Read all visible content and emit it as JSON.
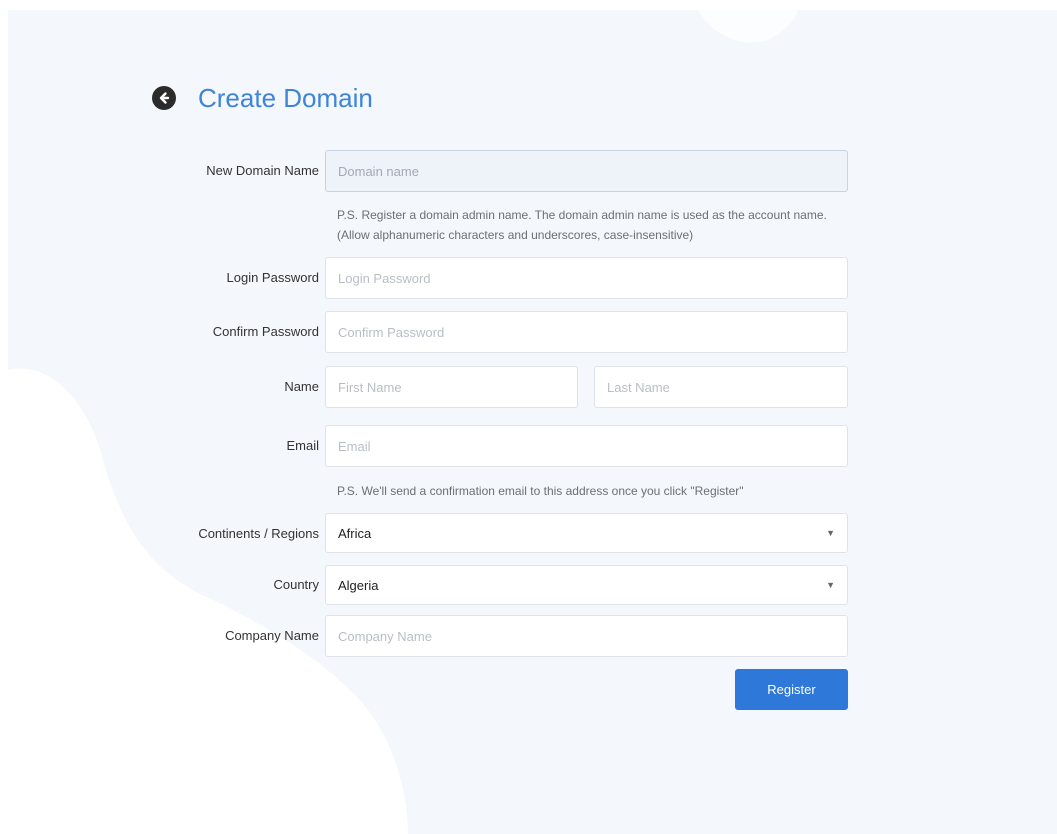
{
  "header": {
    "title": "Create Domain"
  },
  "form": {
    "domain": {
      "label": "New Domain Name",
      "placeholder": "Domain name",
      "value": "",
      "hint_line1": "P.S. Register a domain admin name. The domain admin name is used as the account name.",
      "hint_line2": "(Allow alphanumeric characters and underscores, case-insensitive)"
    },
    "login_password": {
      "label": "Login Password",
      "placeholder": "Login Password"
    },
    "confirm_password": {
      "label": "Confirm Password",
      "placeholder": "Confirm Password"
    },
    "name": {
      "label": "Name",
      "first_placeholder": "First Name",
      "last_placeholder": "Last Name"
    },
    "email": {
      "label": "Email",
      "placeholder": "Email",
      "hint": "P.S. We'll send a confirmation email to this address once you click \"Register\""
    },
    "region": {
      "label": "Continents / Regions",
      "value": "Africa"
    },
    "country": {
      "label": "Country",
      "value": "Algeria"
    },
    "company": {
      "label": "Company Name",
      "placeholder": "Company Name"
    },
    "register_label": "Register"
  },
  "colors": {
    "accent": "#3e84d9",
    "button": "#2d78d9",
    "background": "#f4f7fb"
  },
  "icons": {
    "back": "back-arrow-circle-icon",
    "dropdown": "chevron-down-icon"
  }
}
